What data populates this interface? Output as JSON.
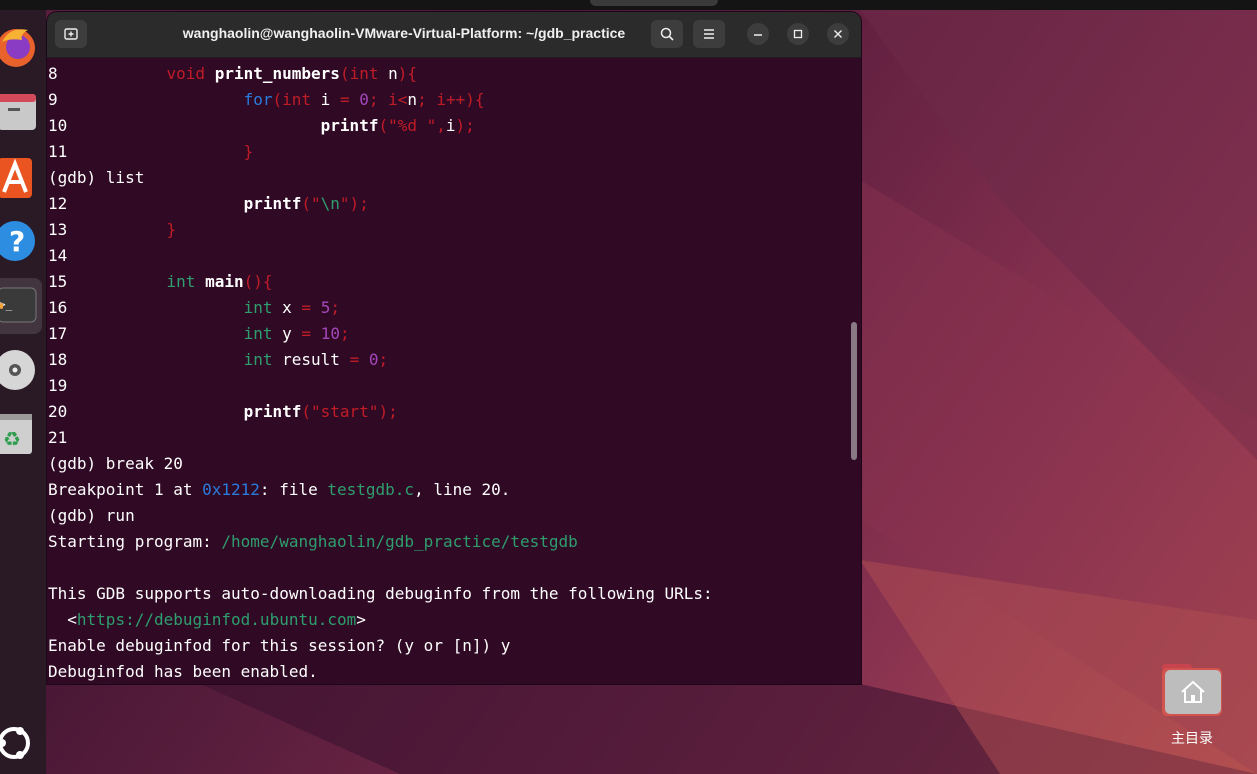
{
  "window": {
    "title": "wanghaolin@wanghaolin-VMware-Virtual-Platform: ~/gdb_practice"
  },
  "terminal": {
    "lines": [
      {
        "num": "8",
        "segments": [
          {
            "t": "void ",
            "c": "pn"
          },
          {
            "t": "print_numbers",
            "c": "bold"
          },
          {
            "t": "(",
            "c": "pn"
          },
          {
            "t": "int",
            "c": "pn"
          },
          {
            "t": " n",
            "c": ""
          },
          {
            "t": "){",
            "c": "pn"
          }
        ],
        "indent": 1
      },
      {
        "num": "9",
        "segments": [
          {
            "t": "for",
            "c": "blu"
          },
          {
            "t": "(",
            "c": "pn"
          },
          {
            "t": "int",
            "c": "pn"
          },
          {
            "t": " i ",
            "c": ""
          },
          {
            "t": "=",
            "c": "pn"
          },
          {
            "t": " ",
            "c": ""
          },
          {
            "t": "0",
            "c": "num"
          },
          {
            "t": "; i",
            "c": "pn"
          },
          {
            "t": "<",
            "c": "pn"
          },
          {
            "t": "n",
            "c": ""
          },
          {
            "t": "; i",
            "c": "pn"
          },
          {
            "t": "++",
            "c": "pn"
          },
          {
            "t": "){",
            "c": "pn"
          }
        ],
        "indent": 2
      },
      {
        "num": "10",
        "segments": [
          {
            "t": "printf",
            "c": "bold"
          },
          {
            "t": "(\"",
            "c": "pn"
          },
          {
            "t": "%d ",
            "c": "pn"
          },
          {
            "t": "\",",
            "c": "pn"
          },
          {
            "t": "i",
            "c": ""
          },
          {
            "t": ");",
            "c": "pn"
          }
        ],
        "indent": 3
      },
      {
        "num": "11",
        "segments": [
          {
            "t": "}",
            "c": "pn"
          }
        ],
        "indent": 2
      },
      {
        "num": "",
        "segments": [
          {
            "t": "(gdb) list",
            "c": ""
          }
        ],
        "indent": 0,
        "raw": true
      },
      {
        "num": "12",
        "segments": [
          {
            "t": "printf",
            "c": "bold"
          },
          {
            "t": "(\"",
            "c": "pn"
          },
          {
            "t": "\\n",
            "c": "grn"
          },
          {
            "t": "\");",
            "c": "pn"
          }
        ],
        "indent": 2
      },
      {
        "num": "13",
        "segments": [
          {
            "t": "}",
            "c": "pn"
          }
        ],
        "indent": 1
      },
      {
        "num": "14",
        "segments": [],
        "indent": 0
      },
      {
        "num": "15",
        "segments": [
          {
            "t": "int",
            "c": "grn"
          },
          {
            "t": " ",
            "c": ""
          },
          {
            "t": "main",
            "c": "bold"
          },
          {
            "t": "(){",
            "c": "pn"
          }
        ],
        "indent": 1
      },
      {
        "num": "16",
        "segments": [
          {
            "t": "int",
            "c": "grn"
          },
          {
            "t": " x ",
            "c": ""
          },
          {
            "t": "=",
            "c": "pn"
          },
          {
            "t": " ",
            "c": ""
          },
          {
            "t": "5",
            "c": "num"
          },
          {
            "t": ";",
            "c": "pn"
          }
        ],
        "indent": 2
      },
      {
        "num": "17",
        "segments": [
          {
            "t": "int",
            "c": "grn"
          },
          {
            "t": " y ",
            "c": ""
          },
          {
            "t": "=",
            "c": "pn"
          },
          {
            "t": " ",
            "c": ""
          },
          {
            "t": "10",
            "c": "num"
          },
          {
            "t": ";",
            "c": "pn"
          }
        ],
        "indent": 2
      },
      {
        "num": "18",
        "segments": [
          {
            "t": "int",
            "c": "grn"
          },
          {
            "t": " result ",
            "c": ""
          },
          {
            "t": "=",
            "c": "pn"
          },
          {
            "t": " ",
            "c": ""
          },
          {
            "t": "0",
            "c": "num"
          },
          {
            "t": ";",
            "c": "pn"
          }
        ],
        "indent": 2
      },
      {
        "num": "19",
        "segments": [],
        "indent": 0
      },
      {
        "num": "20",
        "segments": [
          {
            "t": "printf",
            "c": "bold"
          },
          {
            "t": "(\"",
            "c": "pn"
          },
          {
            "t": "start",
            "c": "pn"
          },
          {
            "t": "\");",
            "c": "pn"
          }
        ],
        "indent": 2
      },
      {
        "num": "21",
        "segments": [],
        "indent": 0
      },
      {
        "num": "",
        "segments": [
          {
            "t": "(gdb) break 20",
            "c": ""
          }
        ],
        "indent": 0,
        "raw": true
      },
      {
        "num": "",
        "segments": [
          {
            "t": "Breakpoint 1 at ",
            "c": ""
          },
          {
            "t": "0x1212",
            "c": "blu"
          },
          {
            "t": ": file ",
            "c": ""
          },
          {
            "t": "testgdb.c",
            "c": "grn"
          },
          {
            "t": ", line 20.",
            "c": ""
          }
        ],
        "indent": 0,
        "raw": true
      },
      {
        "num": "",
        "segments": [
          {
            "t": "(gdb) run",
            "c": ""
          }
        ],
        "indent": 0,
        "raw": true
      },
      {
        "num": "",
        "segments": [
          {
            "t": "Starting program: ",
            "c": ""
          },
          {
            "t": "/home/wanghaolin/gdb_practice/testgdb",
            "c": "grn"
          }
        ],
        "indent": 0,
        "raw": true
      },
      {
        "num": "",
        "segments": [],
        "indent": 0,
        "raw": true
      },
      {
        "num": "",
        "segments": [
          {
            "t": "This GDB supports auto-downloading debuginfo from the following URLs:",
            "c": ""
          }
        ],
        "indent": 0,
        "raw": true
      },
      {
        "num": "",
        "segments": [
          {
            "t": "  <",
            "c": ""
          },
          {
            "t": "https://debuginfod.ubuntu.com",
            "c": "grn"
          },
          {
            "t": ">",
            "c": ""
          }
        ],
        "indent": 0,
        "raw": true
      },
      {
        "num": "",
        "segments": [
          {
            "t": "Enable debuginfod for this session? (y or [n]) y",
            "c": ""
          }
        ],
        "indent": 0,
        "raw": true
      },
      {
        "num": "",
        "segments": [
          {
            "t": "Debuginfod has been enabled.",
            "c": ""
          }
        ],
        "indent": 0,
        "raw": true
      }
    ]
  },
  "desktop": {
    "home_folder_label": "主目录"
  },
  "dock": {
    "items": [
      "firefox-icon",
      "files-icon",
      "app-center-icon",
      "help-icon",
      "terminal-icon",
      "disc-icon",
      "trash-icon"
    ],
    "show_apps": "ubuntu-apps-icon"
  }
}
